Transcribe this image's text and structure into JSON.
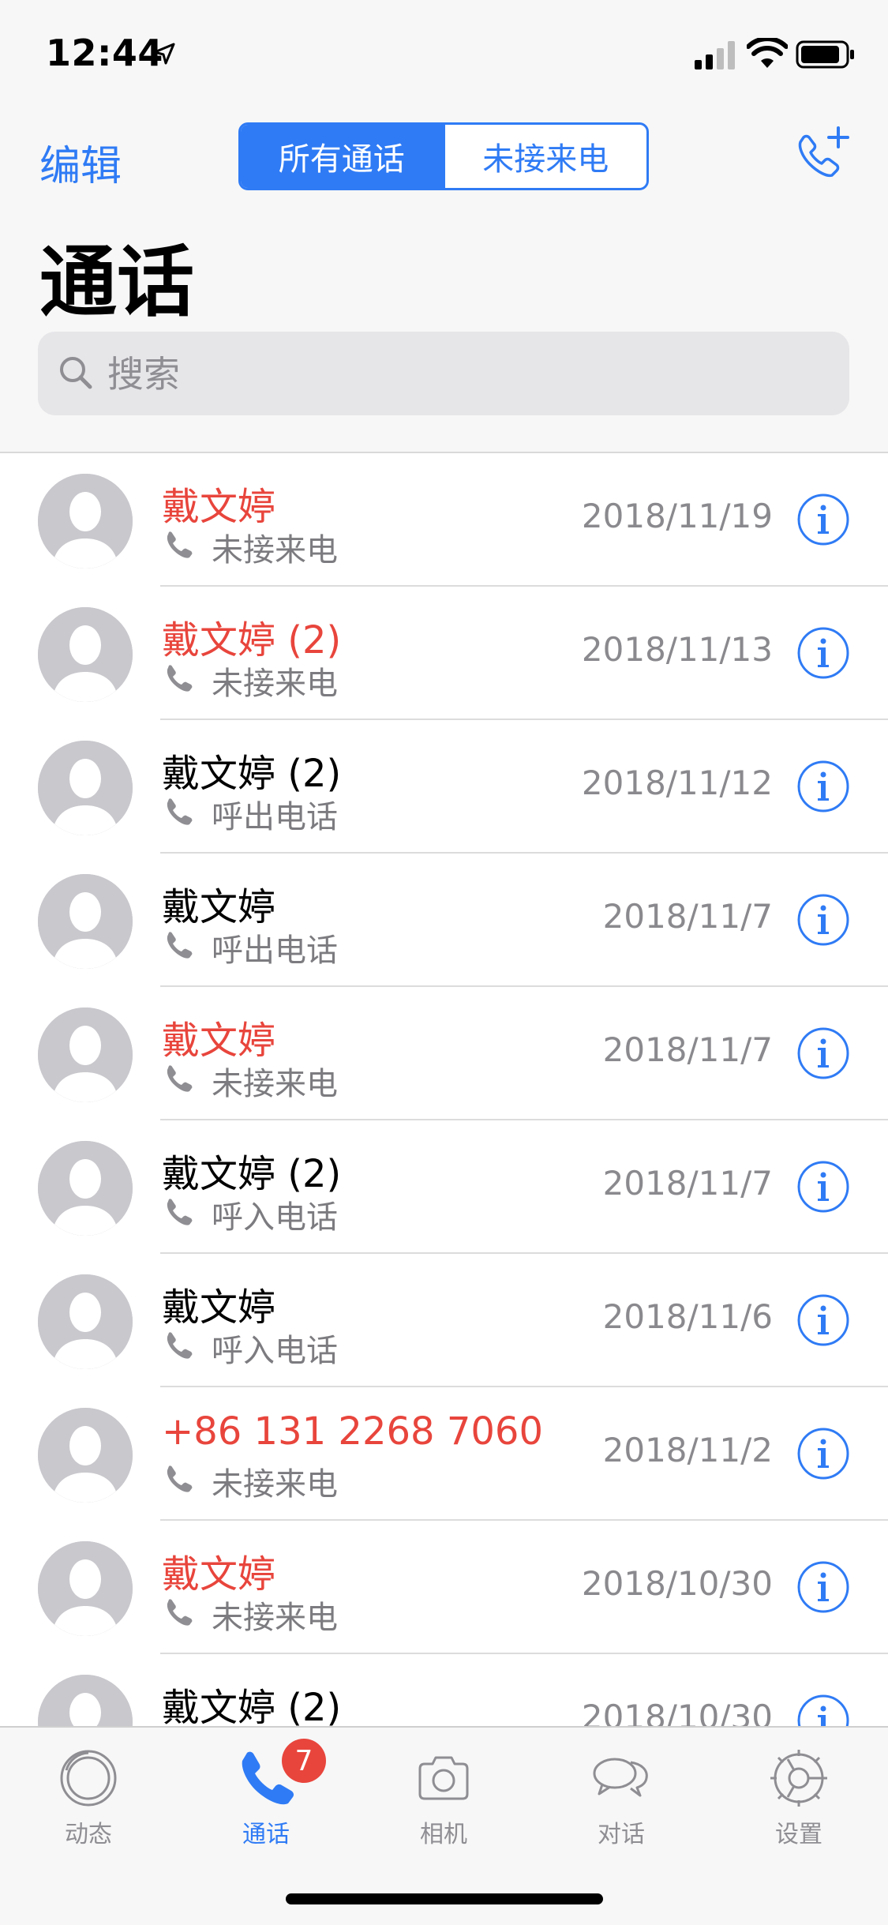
{
  "status_bar": {
    "time": "12:44"
  },
  "nav": {
    "edit_label": "编辑",
    "segments": [
      "所有通话",
      "未接来电"
    ],
    "selected_segment": "所有通话"
  },
  "page_title": "通话",
  "search": {
    "placeholder": "搜索"
  },
  "calls": [
    {
      "name": "戴文婷",
      "type": "未接来电",
      "date": "2018/11/19",
      "missed": true
    },
    {
      "name": "戴文婷 (2)",
      "type": "未接来电",
      "date": "2018/11/13",
      "missed": true
    },
    {
      "name": "戴文婷 (2)",
      "type": "呼出电话",
      "date": "2018/11/12",
      "missed": false
    },
    {
      "name": "戴文婷",
      "type": "呼出电话",
      "date": "2018/11/7",
      "missed": false
    },
    {
      "name": "戴文婷",
      "type": "未接来电",
      "date": "2018/11/7",
      "missed": true
    },
    {
      "name": "戴文婷 (2)",
      "type": "呼入电话",
      "date": "2018/11/7",
      "missed": false
    },
    {
      "name": "戴文婷",
      "type": "呼入电话",
      "date": "2018/11/6",
      "missed": false
    },
    {
      "name": "+86 131 2268 7060",
      "type": "未接来电",
      "date": "2018/11/2",
      "missed": true
    },
    {
      "name": "戴文婷",
      "type": "未接来电",
      "date": "2018/10/30",
      "missed": true
    },
    {
      "name": "戴文婷 (2)",
      "type": "",
      "date": "2018/10/30",
      "missed": false
    }
  ],
  "tabs": [
    {
      "label": "动态",
      "icon": "moments-icon"
    },
    {
      "label": "通话",
      "icon": "phone-icon",
      "badge": "7",
      "active": true
    },
    {
      "label": "相机",
      "icon": "camera-icon"
    },
    {
      "label": "对话",
      "icon": "chat-icon"
    },
    {
      "label": "设置",
      "icon": "settings-gear-icon"
    }
  ],
  "colors": {
    "accent": "#2f7bf5",
    "missed": "#e8453c",
    "secondary_text": "#8a8a8e",
    "badge": "#e8453c"
  }
}
